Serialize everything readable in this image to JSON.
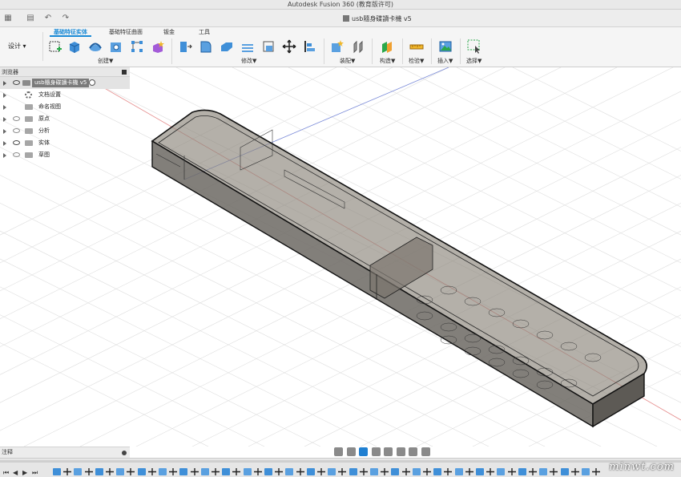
{
  "window": {
    "title": "Autodesk Fusion 360 (教育版许可)"
  },
  "document_tab": {
    "name": "usb隨身碟讀卡機 v5"
  },
  "workspace": {
    "label": "设计 ▾"
  },
  "ribbon_tabs": [
    {
      "label": "基础特征实体",
      "active": true
    },
    {
      "label": "基础特征曲面",
      "active": false
    },
    {
      "label": "钣金",
      "active": false
    },
    {
      "label": "工具",
      "active": false
    }
  ],
  "ribbon_groups": {
    "create": "创建▼",
    "modify": "修改▼",
    "assemble": "装配▼",
    "construct": "构造▼",
    "inspect": "检验▼",
    "insert": "插入▼",
    "select": "选择▼"
  },
  "browser": {
    "header": "浏览器",
    "root": "usb隨身碟讀卡機 v5",
    "items": [
      {
        "label": "文档设置",
        "icon": "gear-icon"
      },
      {
        "label": "命名视图",
        "icon": "folder-icon"
      },
      {
        "label": "原点",
        "icon": "folder-icon"
      },
      {
        "label": "分析",
        "icon": "folder-icon"
      },
      {
        "label": "实体",
        "icon": "folder-icon"
      },
      {
        "label": "草图",
        "icon": "folder-icon"
      }
    ]
  },
  "comments": {
    "label": "注释"
  },
  "watermark": {
    "text": "minwt.com"
  },
  "colors": {
    "accent": "#1a8ad6",
    "body": "#6f6a62",
    "grid": "#d9d9d9"
  }
}
